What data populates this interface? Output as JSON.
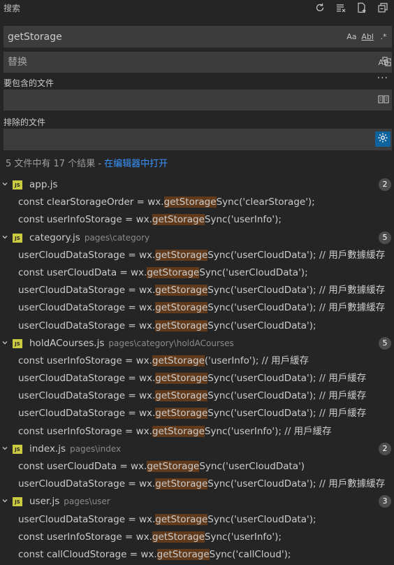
{
  "header": {
    "title": "搜索",
    "icons": [
      "refresh-icon",
      "clear-results-icon",
      "new-search-editor-icon",
      "collapse-all-icon"
    ]
  },
  "search": {
    "value": "getStorage",
    "match_case": "Aa",
    "whole_word": "Abl",
    "regex": ".*"
  },
  "replace": {
    "placeholder": "替换",
    "preserve_case": "AB"
  },
  "include": {
    "label": "要包含的文件",
    "value": ""
  },
  "exclude": {
    "label": "排除的文件",
    "value": ""
  },
  "more_label": "···",
  "summary": {
    "text": "5 文件中有 17 个结果 - ",
    "link": "在编辑器中打开"
  },
  "highlight_color": "#613a1b",
  "results": [
    {
      "name": "app.js",
      "path": "",
      "count": "2",
      "lines": [
        {
          "pre": "const clearStorageOrder = wx.",
          "match": "getStorage",
          "post": "Sync('clearStorage');"
        },
        {
          "pre": "const userInfoStorage = wx.",
          "match": "getStorage",
          "post": "Sync('userInfo');"
        }
      ]
    },
    {
      "name": "category.js",
      "path": "pages\\category",
      "count": "5",
      "lines": [
        {
          "pre": "userCloudDataStorage = wx.",
          "match": "getStorage",
          "post": "Sync('userCloudData');  // 用戶數據緩存"
        },
        {
          "pre": "const userCloudData = wx.",
          "match": "getStorage",
          "post": "Sync('userCloudData');"
        },
        {
          "pre": "userCloudDataStorage = wx.",
          "match": "getStorage",
          "post": "Sync('userCloudData');  // 用戶數據緩存"
        },
        {
          "pre": "userCloudDataStorage = wx.",
          "match": "getStorage",
          "post": "Sync('userCloudData');  // 用戶數據緩存"
        },
        {
          "pre": "userCloudDataStorage = wx.",
          "match": "getStorage",
          "post": "Sync('userCloudData');"
        }
      ]
    },
    {
      "name": "holdACourses.js",
      "path": "pages\\category\\holdACourses",
      "count": "5",
      "lines": [
        {
          "pre": "const userInfoStorage = wx.",
          "match": "getStorage",
          "post": "('userInfo');  // 用戶緩存"
        },
        {
          "pre": "userCloudDataStorage = wx.",
          "match": "getStorage",
          "post": "Sync('userCloudData');  // 用戶緩存"
        },
        {
          "pre": "userCloudDataStorage = wx.",
          "match": "getStorage",
          "post": "Sync('userCloudData');  // 用戶緩存"
        },
        {
          "pre": "userCloudDataStorage = wx.",
          "match": "getStorage",
          "post": "Sync('userCloudData');  // 用戶緩存"
        },
        {
          "pre": "const userInfoStorage = wx.",
          "match": "getStorage",
          "post": "Sync('userInfo');  // 用戶緩存"
        }
      ]
    },
    {
      "name": "index.js",
      "path": "pages\\index",
      "count": "2",
      "lines": [
        {
          "pre": "const userCloudData = wx.",
          "match": "getStorage",
          "post": "Sync('userCloudData')"
        },
        {
          "pre": "userCloudDataStorage = wx.",
          "match": "getStorage",
          "post": "Sync('userCloudData');  // 用戶數據緩存"
        }
      ]
    },
    {
      "name": "user.js",
      "path": "pages\\user",
      "count": "3",
      "lines": [
        {
          "pre": "userCloudDataStorage = wx.",
          "match": "getStorage",
          "post": "Sync('userCloudData');"
        },
        {
          "pre": "const userInfoStorage = wx.",
          "match": "getStorage",
          "post": "Sync('userInfo');"
        },
        {
          "pre": "const callCloudStorage = wx.",
          "match": "getStorage",
          "post": "Sync('callCloud');"
        }
      ]
    }
  ]
}
